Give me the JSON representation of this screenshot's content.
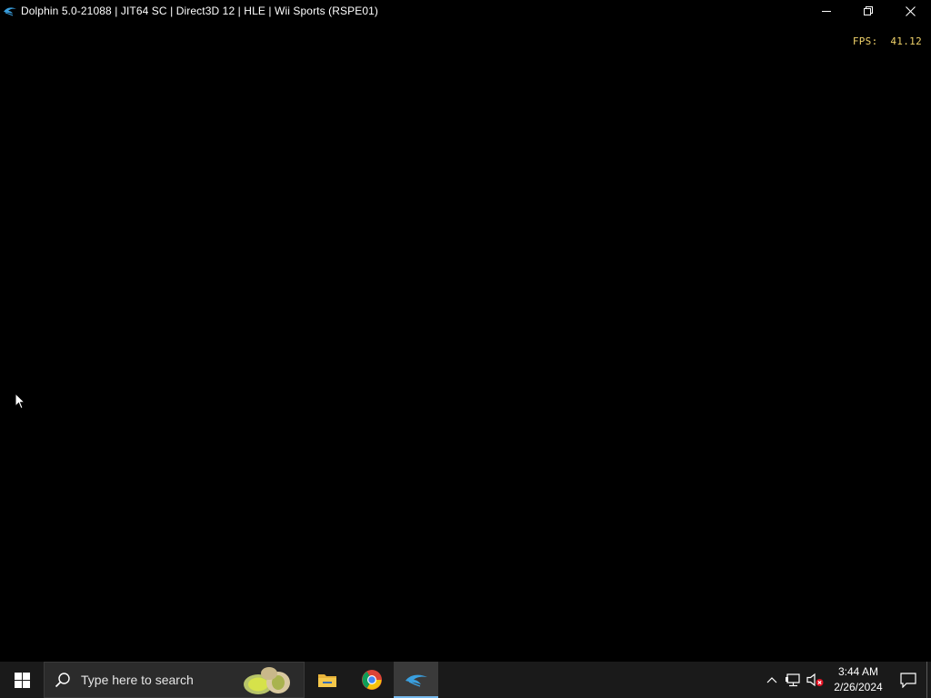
{
  "window": {
    "title": "Dolphin 5.0-21088 | JIT64 SC | Direct3D 12 | HLE | Wii Sports (RSPE01)",
    "icon": "dolphin-icon",
    "controls": [
      "minimize-icon",
      "restore-icon",
      "close-icon"
    ]
  },
  "overlay": {
    "fps_label": "FPS:",
    "fps_value": "41.12",
    "fps_color": "#f0d26a"
  },
  "taskbar": {
    "start_icon": "windows-logo-icon",
    "search_placeholder": "Type here to search",
    "pinned": [
      {
        "name": "File Explorer",
        "icon": "folder-icon",
        "active": false
      },
      {
        "name": "Google Chrome",
        "icon": "chrome-icon",
        "active": false
      },
      {
        "name": "Dolphin",
        "icon": "dolphin-icon",
        "active": true
      }
    ],
    "tray": {
      "icons": [
        "chevron-up-icon",
        "network-icon",
        "volume-muted-icon"
      ],
      "time": "3:44 AM",
      "date": "2/26/2024"
    },
    "accent": "#76b9ed"
  }
}
